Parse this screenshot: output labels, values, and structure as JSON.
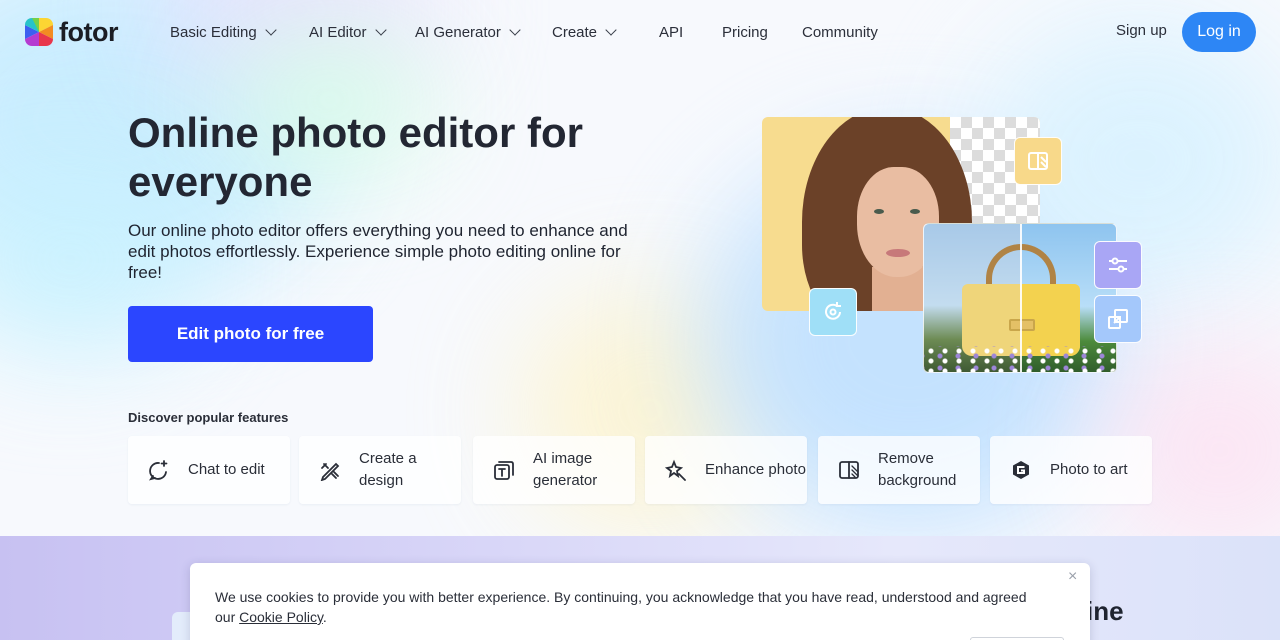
{
  "brand": {
    "logo_text": "fotor"
  },
  "nav": {
    "items": [
      {
        "label": "Basic Editing",
        "has_dropdown": true
      },
      {
        "label": "AI Editor",
        "has_dropdown": true
      },
      {
        "label": "AI Generator",
        "has_dropdown": true
      },
      {
        "label": "Create",
        "has_dropdown": true
      },
      {
        "label": "API",
        "has_dropdown": false
      },
      {
        "label": "Pricing",
        "has_dropdown": false
      },
      {
        "label": "Community",
        "has_dropdown": false
      }
    ],
    "sign_up": "Sign up",
    "log_in": "Log in"
  },
  "hero": {
    "title": "Online photo editor for everyone",
    "subtitle": "Our online photo editor offers everything you need to enhance and edit photos effortlessly. Experience simple photo editing online for free!",
    "cta": "Edit photo for free",
    "discover_label": "Discover popular features"
  },
  "features": [
    {
      "label": "Chat to edit",
      "icon": "chat-sparkle-icon"
    },
    {
      "label": "Create a design",
      "icon": "pencil-ruler-icon"
    },
    {
      "label": "AI image generator",
      "icon": "image-text-icon"
    },
    {
      "label": "Enhance photo",
      "icon": "sparkle-wand-icon"
    },
    {
      "label": "Remove background",
      "icon": "cutout-icon"
    },
    {
      "label": "Photo to art",
      "icon": "art-g-icon"
    }
  ],
  "lower": {
    "heading_fragment": "ine"
  },
  "cookie": {
    "text": "We use cookies to provide you with better experience. By continuing, you acknowledge that you have read, understood and agreed our ",
    "link": "Cookie Policy",
    "suffix": ".",
    "close": "×"
  },
  "colors": {
    "login_button": "#2d86f5",
    "cta_button": "#2b46ff",
    "text_dark": "#232733"
  }
}
